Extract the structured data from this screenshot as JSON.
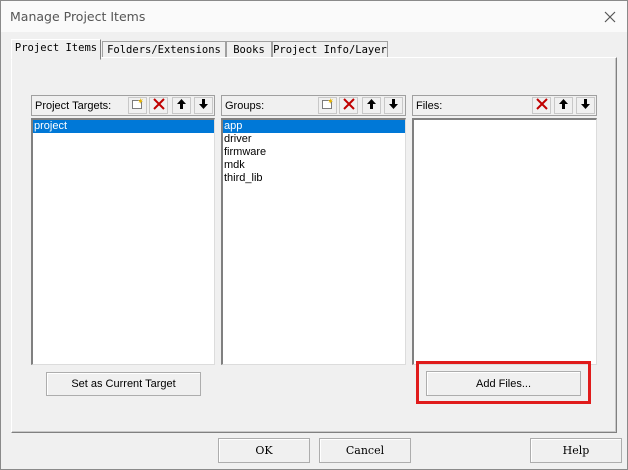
{
  "window": {
    "title": "Manage Project Items"
  },
  "tabs": [
    {
      "label": "Project Items",
      "active": true
    },
    {
      "label": "Folders/Extensions",
      "active": false
    },
    {
      "label": "Books",
      "active": false
    },
    {
      "label": "Project Info/Layer",
      "active": false
    }
  ],
  "targets": {
    "label": "Project Targets:",
    "items": [
      "project"
    ],
    "selected": "project"
  },
  "groups": {
    "label": "Groups:",
    "items": [
      "app",
      "driver",
      "firmware",
      "mdk",
      "third_lib"
    ],
    "selected": "app"
  },
  "files": {
    "label": "Files:",
    "items": []
  },
  "buttons": {
    "set_current": "Set as Current Target",
    "add_files": "Add Files...",
    "ok": "OK",
    "cancel": "Cancel",
    "help": "Help"
  },
  "icons": {
    "new": "new-item-icon",
    "delete": "delete-icon",
    "up": "move-up-icon",
    "down": "move-down-icon",
    "close": "close-icon"
  },
  "colors": {
    "selection": "#0078d7",
    "delete_red": "#c00000",
    "highlight": "#e01b1b"
  }
}
